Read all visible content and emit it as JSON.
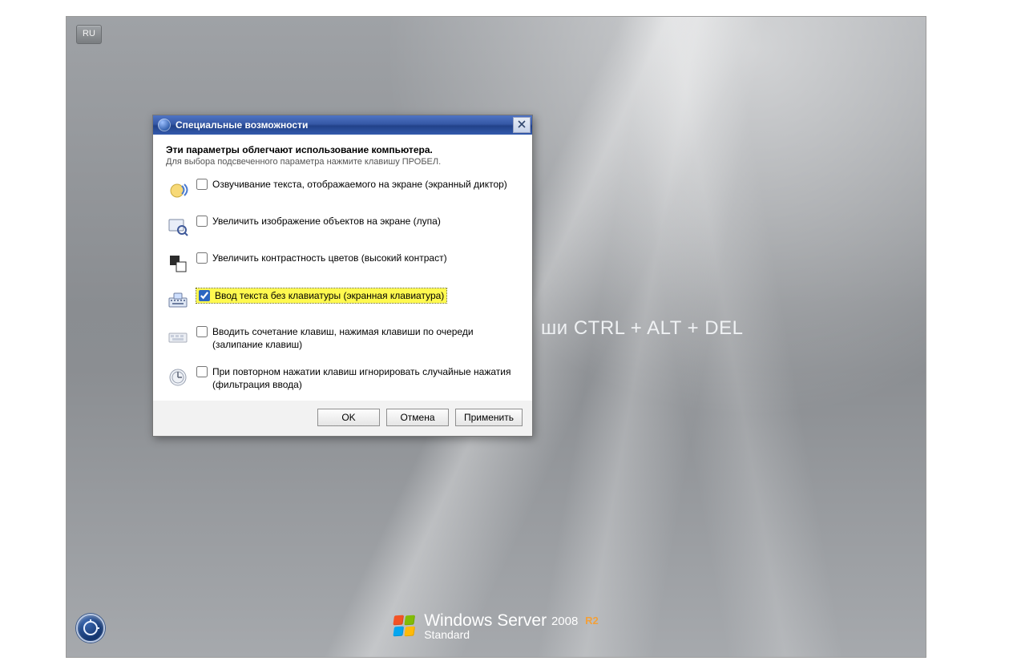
{
  "lang_indicator": "RU",
  "background_hint_text": "ши CTRL + ALT + DEL",
  "branding": {
    "line1_prefix": "Windows Server",
    "year": "2008",
    "r2": "R2",
    "line2": "Standard"
  },
  "dialog": {
    "title": "Специальные возможности",
    "heading": "Эти параметры облегчают использование компьютера.",
    "subheading": "Для выбора подсвеченного параметра нажмите клавишу ПРОБЕЛ.",
    "options": [
      {
        "id": "narrator",
        "label": "Озвучивание текста, отображаемого на экране (экранный диктор)",
        "checked": false,
        "highlighted": false
      },
      {
        "id": "magnifier",
        "label": "Увеличить изображение объектов на экране (лупа)",
        "checked": false,
        "highlighted": false
      },
      {
        "id": "high-contrast",
        "label": "Увеличить контрастность цветов (высокий контраст)",
        "checked": false,
        "highlighted": false
      },
      {
        "id": "osk",
        "label": "Ввод текста без клавиатуры (экранная клавиатура)",
        "checked": true,
        "highlighted": true
      },
      {
        "id": "sticky-keys",
        "label": "Вводить сочетание клавиш, нажимая клавиши по очереди (залипание клавиш)",
        "checked": false,
        "highlighted": false
      },
      {
        "id": "filter-keys",
        "label": "При повторном нажатии клавиш игнорировать случайные нажатия (фильтрация ввода)",
        "checked": false,
        "highlighted": false
      }
    ],
    "buttons": {
      "ok": "OK",
      "cancel": "Отмена",
      "apply": "Применить"
    }
  }
}
